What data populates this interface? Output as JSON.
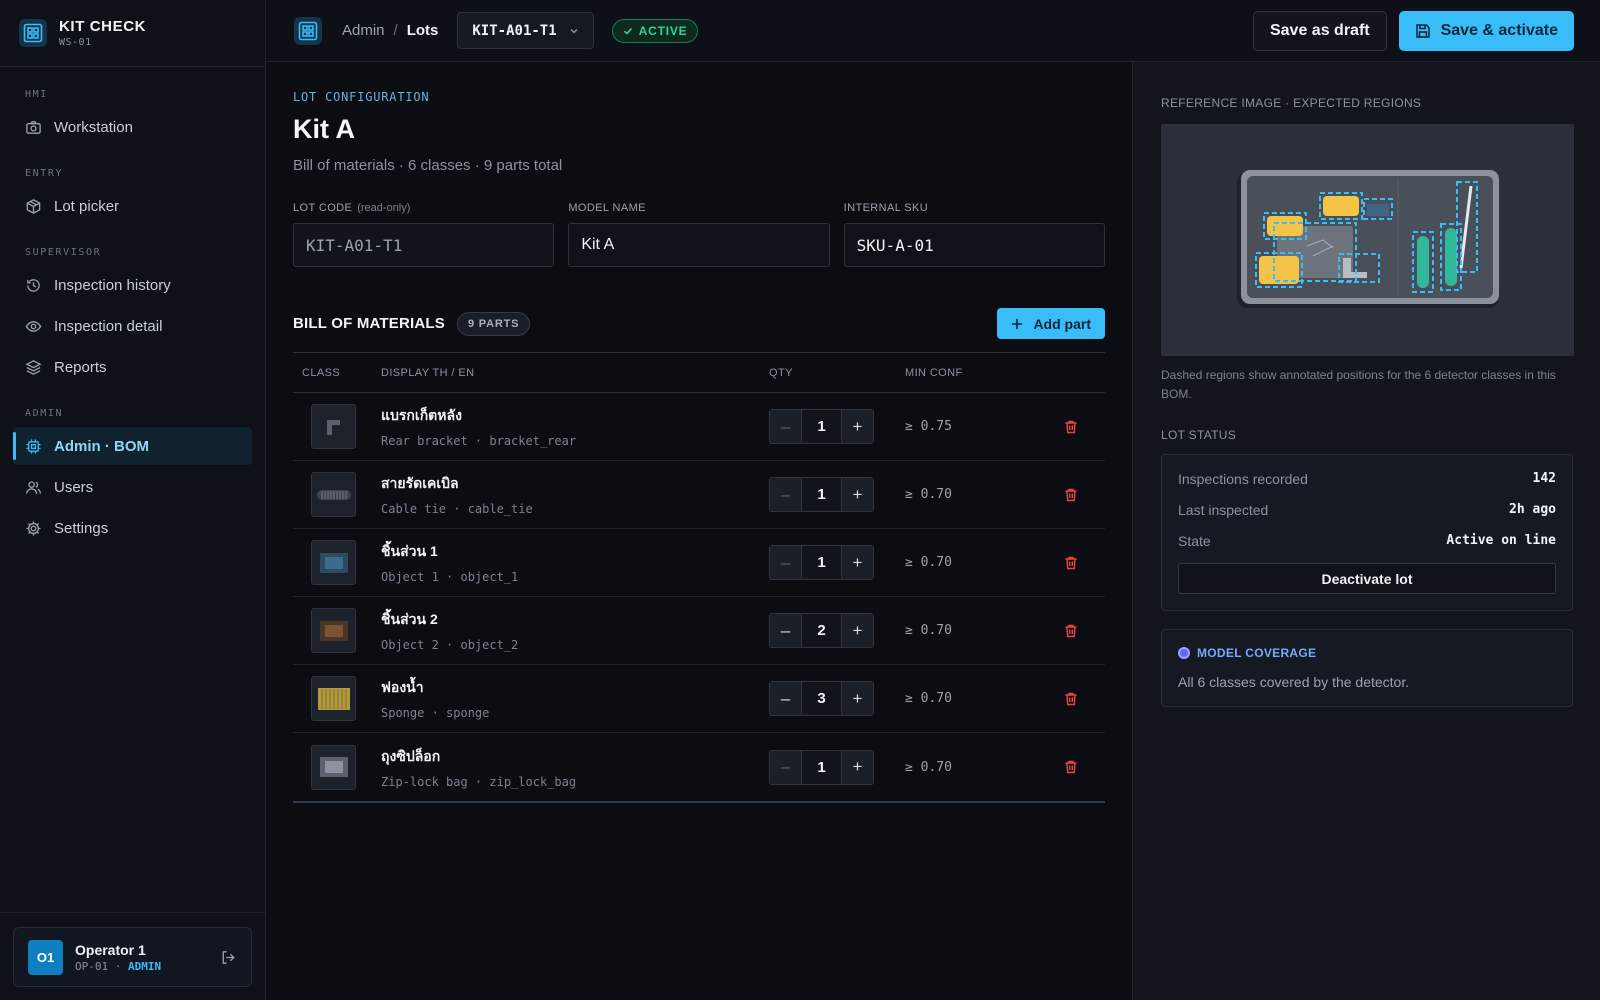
{
  "brand": {
    "title": "KIT CHECK",
    "station": "WS-01"
  },
  "sidebar": {
    "sections": [
      {
        "label": "HMI",
        "items": [
          {
            "label": "Workstation",
            "icon": "camera-icon"
          }
        ]
      },
      {
        "label": "ENTRY",
        "items": [
          {
            "label": "Lot picker",
            "icon": "box-icon"
          }
        ]
      },
      {
        "label": "SUPERVISOR",
        "items": [
          {
            "label": "Inspection history",
            "icon": "history-icon"
          },
          {
            "label": "Inspection detail",
            "icon": "eye-icon"
          },
          {
            "label": "Reports",
            "icon": "layers-icon"
          }
        ]
      },
      {
        "label": "ADMIN",
        "items": [
          {
            "label": "Admin · BOM",
            "icon": "chip-icon",
            "active": true
          },
          {
            "label": "Users",
            "icon": "users-icon"
          },
          {
            "label": "Settings",
            "icon": "gear-icon"
          }
        ]
      }
    ]
  },
  "user": {
    "initials": "O1",
    "name": "Operator 1",
    "id": "OP-01",
    "separator": "·",
    "role": "ADMIN"
  },
  "topbar": {
    "breadcrumb_root": "Admin",
    "breadcrumb_sep": "/",
    "breadcrumb_current": "Lots",
    "lot_code": "KIT-A01-T1",
    "status": "ACTIVE",
    "save_draft": "Save as draft",
    "save_activate": "Save & activate"
  },
  "main": {
    "eyebrow": "LOT CONFIGURATION",
    "title": "Kit A",
    "subtitle": "Bill of materials · 6 classes · 9 parts total",
    "fields": {
      "lot_code": {
        "label": "LOT CODE",
        "note": "(read-only)",
        "value": "KIT-A01-T1"
      },
      "model_name": {
        "label": "MODEL NAME",
        "value": "Kit A"
      },
      "sku": {
        "label": "INTERNAL SKU",
        "value": "SKU-A-01"
      }
    },
    "bom": {
      "title": "BILL OF MATERIALS",
      "count": "9 PARTS",
      "add_label": "Add part",
      "columns": {
        "class": "CLASS",
        "display": "DISPLAY TH / EN",
        "qty": "QTY",
        "conf": "MIN CONF"
      },
      "minus": "–",
      "plus": "+",
      "rows": [
        {
          "th": "แบรกเก็ตหลัง",
          "en": "Rear bracket · bracket_rear",
          "qty": "1",
          "conf": "≥ 0.75",
          "thumb": "bracket-thumb-icon"
        },
        {
          "th": "สายรัดเคเบิล",
          "en": "Cable tie · cable_tie",
          "qty": "1",
          "conf": "≥ 0.70",
          "thumb": "cable-tie-thumb-icon"
        },
        {
          "th": "ชิ้นส่วน 1",
          "en": "Object 1 · object_1",
          "qty": "1",
          "conf": "≥ 0.70",
          "thumb": "object-1-thumb-icon",
          "color": "#3b6c8e"
        },
        {
          "th": "ชิ้นส่วน 2",
          "en": "Object 2 · object_2",
          "qty": "2",
          "conf": "≥ 0.70",
          "thumb": "object-2-thumb-icon",
          "color": "#7a5236"
        },
        {
          "th": "ฟองน้ำ",
          "en": "Sponge · sponge",
          "qty": "3",
          "conf": "≥ 0.70",
          "thumb": "sponge-thumb-icon",
          "color": "#b49a3e"
        },
        {
          "th": "ถุงซิปล็อก",
          "en": "Zip-lock bag · zip_lock_bag",
          "qty": "1",
          "conf": "≥ 0.70",
          "thumb": "ziplock-thumb-icon",
          "color": "#8d939e"
        }
      ]
    }
  },
  "panel": {
    "ref_label": "REFERENCE IMAGE · EXPECTED REGIONS",
    "ref_note": "Dashed regions show annotated positions for the 6 detector classes in this BOM.",
    "status_label": "LOT STATUS",
    "status_rows": [
      {
        "k": "Inspections recorded",
        "v": "142"
      },
      {
        "k": "Last inspected",
        "v": "2h ago"
      },
      {
        "k": "State",
        "v": "Active on line"
      }
    ],
    "deactivate": "Deactivate lot",
    "coverage_title": "MODEL COVERAGE",
    "coverage_text": "All 6 classes covered by the detector."
  },
  "colors": {
    "accent": "#38bdf8",
    "active": "#34d399",
    "danger": "#ef4444",
    "coverage": "#6366f1"
  }
}
